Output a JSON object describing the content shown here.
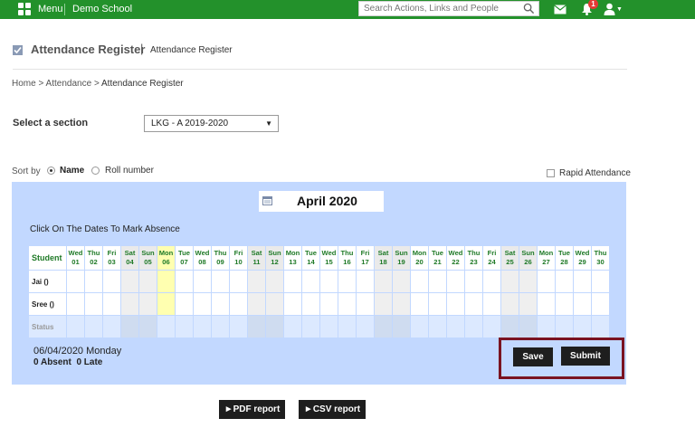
{
  "topbar": {
    "menu_label": "Menu",
    "school_name": "Demo School",
    "search_placeholder": "Search Actions, Links and People",
    "notification_count": "1",
    "accent_color": "#23912b"
  },
  "page": {
    "title": "Attendance Register",
    "subtitle": "Attendance Register",
    "breadcrumb": {
      "home": "Home",
      "sep": ">",
      "attendance": "Attendance",
      "current": "Attendance Register"
    }
  },
  "section": {
    "label": "Select a section",
    "selected": "LKG - A 2019-2020"
  },
  "sort": {
    "label": "Sort by",
    "options": [
      {
        "label": "Name",
        "selected": true
      },
      {
        "label": "Roll number",
        "selected": false
      }
    ],
    "rapid_label": "Rapid Attendance",
    "rapid_checked": false
  },
  "register": {
    "month": "April 2020",
    "instruction": "Click On The Dates To Mark Absence",
    "student_header": "Student",
    "days": [
      {
        "dow": "Wed",
        "date": "01",
        "weekend": false,
        "today": false
      },
      {
        "dow": "Thu",
        "date": "02",
        "weekend": false,
        "today": false
      },
      {
        "dow": "Fri",
        "date": "03",
        "weekend": false,
        "today": false
      },
      {
        "dow": "Sat",
        "date": "04",
        "weekend": true,
        "today": false
      },
      {
        "dow": "Sun",
        "date": "05",
        "weekend": true,
        "today": false
      },
      {
        "dow": "Mon",
        "date": "06",
        "weekend": false,
        "today": true
      },
      {
        "dow": "Tue",
        "date": "07",
        "weekend": false,
        "today": false
      },
      {
        "dow": "Wed",
        "date": "08",
        "weekend": false,
        "today": false
      },
      {
        "dow": "Thu",
        "date": "09",
        "weekend": false,
        "today": false
      },
      {
        "dow": "Fri",
        "date": "10",
        "weekend": false,
        "today": false
      },
      {
        "dow": "Sat",
        "date": "11",
        "weekend": true,
        "today": false
      },
      {
        "dow": "Sun",
        "date": "12",
        "weekend": true,
        "today": false
      },
      {
        "dow": "Mon",
        "date": "13",
        "weekend": false,
        "today": false
      },
      {
        "dow": "Tue",
        "date": "14",
        "weekend": false,
        "today": false
      },
      {
        "dow": "Wed",
        "date": "15",
        "weekend": false,
        "today": false
      },
      {
        "dow": "Thu",
        "date": "16",
        "weekend": false,
        "today": false
      },
      {
        "dow": "Fri",
        "date": "17",
        "weekend": false,
        "today": false
      },
      {
        "dow": "Sat",
        "date": "18",
        "weekend": true,
        "today": false
      },
      {
        "dow": "Sun",
        "date": "19",
        "weekend": true,
        "today": false
      },
      {
        "dow": "Mon",
        "date": "20",
        "weekend": false,
        "today": false
      },
      {
        "dow": "Tue",
        "date": "21",
        "weekend": false,
        "today": false
      },
      {
        "dow": "Wed",
        "date": "22",
        "weekend": false,
        "today": false
      },
      {
        "dow": "Thu",
        "date": "23",
        "weekend": false,
        "today": false
      },
      {
        "dow": "Fri",
        "date": "24",
        "weekend": false,
        "today": false
      },
      {
        "dow": "Sat",
        "date": "25",
        "weekend": true,
        "today": false
      },
      {
        "dow": "Sun",
        "date": "26",
        "weekend": true,
        "today": false
      },
      {
        "dow": "Mon",
        "date": "27",
        "weekend": false,
        "today": false
      },
      {
        "dow": "Tue",
        "date": "28",
        "weekend": false,
        "today": false
      },
      {
        "dow": "Wed",
        "date": "29",
        "weekend": false,
        "today": false
      },
      {
        "dow": "Thu",
        "date": "30",
        "weekend": false,
        "today": false
      }
    ],
    "students": [
      {
        "name": "Jai ()"
      },
      {
        "name": "Sree ()"
      }
    ],
    "status_label": "Status"
  },
  "summary": {
    "date_line": "06/04/2020 Monday",
    "absent_line": "0 Absent",
    "late_line": "0 Late"
  },
  "actions": {
    "save_label": "Save",
    "submit_label": "Submit",
    "pdf_label": "►PDF report",
    "csv_label": "►CSV report"
  }
}
